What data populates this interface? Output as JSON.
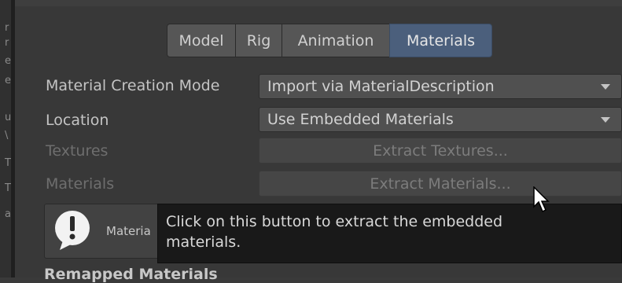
{
  "tabs": [
    {
      "label": "Model"
    },
    {
      "label": "Rig"
    },
    {
      "label": "Animation"
    },
    {
      "label": "Materials",
      "active": true
    }
  ],
  "left_strip_glyphs": [
    "r",
    "r",
    "e",
    "e",
    "u",
    "\\",
    "T",
    "T",
    "a"
  ],
  "fields": {
    "material_creation_mode": {
      "label": "Material Creation Mode",
      "value": "Import via MaterialDescription"
    },
    "location": {
      "label": "Location",
      "value": "Use Embedded Materials"
    },
    "textures": {
      "label": "Textures",
      "button": "Extract Textures..."
    },
    "materials": {
      "label": "Materials",
      "button": "Extract Materials..."
    }
  },
  "helpbox": {
    "text": "Materia",
    "icon": "info-speech-bubble-icon"
  },
  "tooltip": {
    "line1": "Click on this button to extract the embedded",
    "line2": "materials."
  },
  "section": {
    "title": "Remapped Materials"
  },
  "colors": {
    "active_tab": "#4b5f7c",
    "background": "#383838"
  }
}
